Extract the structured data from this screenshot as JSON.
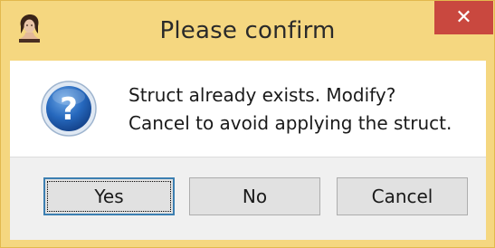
{
  "window": {
    "title": "Please confirm",
    "close_glyph": "✕",
    "app_icon": "portrait-app-icon"
  },
  "dialog": {
    "icon": "question-icon",
    "icon_glyph": "?",
    "message_line1": "Struct already exists. Modify?",
    "message_line2": "Cancel to avoid applying the struct."
  },
  "buttons": {
    "yes_label": "Yes",
    "no_label": "No",
    "cancel_label": "Cancel"
  },
  "colors": {
    "title_bar": "#f5d780",
    "close_button": "#c9483f",
    "question_icon": "#1f5fae",
    "default_button_border": "#3c7fb1"
  }
}
